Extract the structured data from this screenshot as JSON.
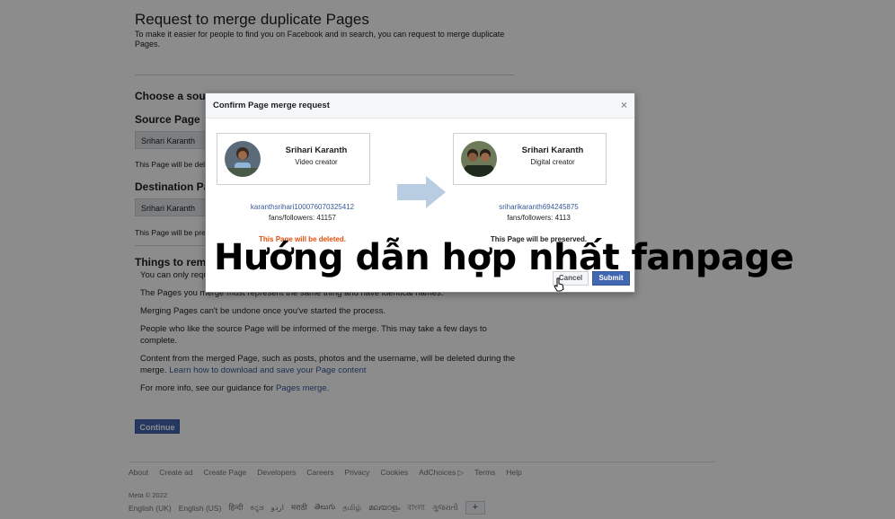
{
  "page": {
    "title": "Request to merge duplicate Pages",
    "subtitle": "To make it easier for people to find you on Facebook and in search, you can request to merge duplicate Pages.",
    "choose_label": "Choose a source",
    "source_label": "Source Page",
    "source_value": "Srihari Karanth",
    "source_note": "This Page will be deleted",
    "destination_label": "Destination Page",
    "destination_value": "Srihari Karanth",
    "destination_note": "This Page will be preserved",
    "remember_label": "Things to remember",
    "remember_items": [
      "You can only request to merge Pages that you manage.",
      "The Pages you merge must represent the same thing and have identical names.",
      "Merging Pages can't be undone once you've started the process.",
      "People who like the source Page will be informed of the merge. This may take a few days to complete.",
      "Content from the merged Page, such as posts, photos and the username, will be deleted during the merge.",
      "For more info, see our guidance for"
    ],
    "learn_link": "Learn how to download and save your Page content",
    "pages_merge_link": "Pages merge.",
    "continue_label": "Continue"
  },
  "footer": {
    "links": [
      "About",
      "Create ad",
      "Create Page",
      "Developers",
      "Careers",
      "Privacy",
      "Cookies",
      "AdChoices",
      "Terms",
      "Help"
    ],
    "copyright": "Meta © 2022",
    "languages": [
      "English (UK)",
      "English (US)",
      "हिन्दी",
      "ಕನ್ನಡ",
      "اردو",
      "मराठी",
      "తెలుగు",
      "தமிழ்",
      "മലയാളം",
      "বাংলা",
      "ગુજરાતી"
    ],
    "more_label": "+"
  },
  "modal": {
    "title": "Confirm Page merge request",
    "close_label": "×",
    "source": {
      "name": "Srihari Karanth",
      "role": "Video creator",
      "id": "karanthsrihari100076070325412",
      "fans": "fans/followers: 41157",
      "status": "This Page will be deleted."
    },
    "destination": {
      "name": "Srihari Karanth",
      "role": "Digital creator",
      "id": "sriharikaranth694245875",
      "fans": "fans/followers: 4113",
      "status": "This Page will be preserved."
    },
    "cancel_label": "Cancel",
    "submit_label": "Submit"
  },
  "caption": "Hướng dẫn hợp nhất fanpage",
  "colors": {
    "accent": "#4267b2",
    "deleted": "#e0500c",
    "overlay": "rgba(0,0,0,0.45)"
  }
}
